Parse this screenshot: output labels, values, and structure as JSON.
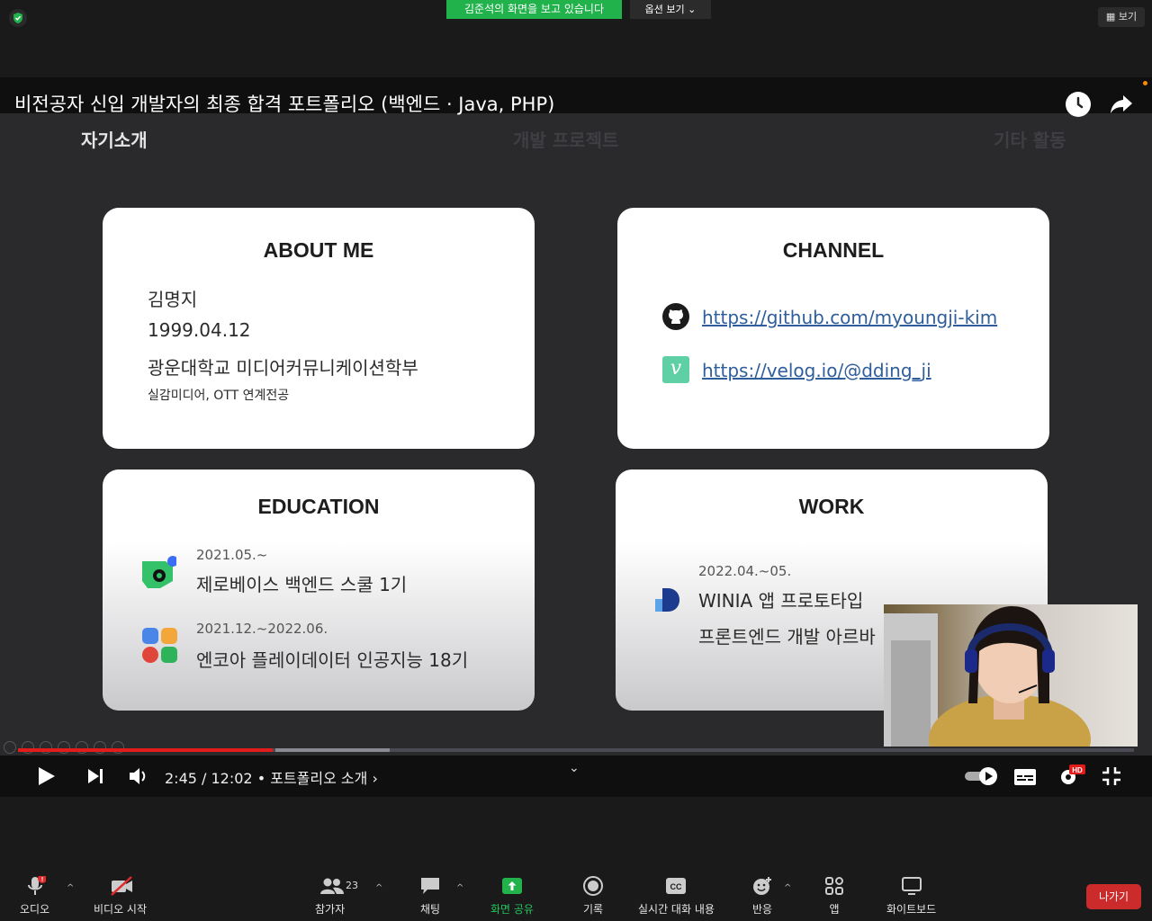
{
  "zoom": {
    "sharing_banner": "김준석의 화면을 보고 있습니다",
    "view_options": "옵션 보기",
    "view_button": "보기",
    "toolbar": [
      {
        "label": "오디오",
        "icon": "mic-icon"
      },
      {
        "label": "비디오 시작",
        "icon": "video-off-icon"
      },
      {
        "label": "참가자",
        "icon": "participants-icon"
      },
      {
        "label": "채팅",
        "icon": "chat-icon"
      },
      {
        "label": "화면 공유",
        "icon": "share-screen-icon"
      },
      {
        "label": "기록",
        "icon": "record-icon"
      },
      {
        "label": "실시간 대화 내용",
        "icon": "cc-icon"
      },
      {
        "label": "반응",
        "icon": "reaction-icon"
      },
      {
        "label": "앱",
        "icon": "apps-icon"
      },
      {
        "label": "화이트보드",
        "icon": "whiteboard-icon"
      }
    ],
    "participants_count": "23",
    "leave_button": "나가기",
    "share_accent": "#22b24c",
    "leave_color": "#cc2b2b"
  },
  "video": {
    "title": "비전공자 신입 개발자의 최종 합격 포트폴리오 (백엔드 · Java, PHP)",
    "slide_tabs": [
      "자기소개",
      "개발 프로젝트",
      "기타 활동"
    ],
    "about": {
      "title": "ABOUT ME",
      "name": "김명지",
      "birth": "1999.04.12",
      "school": "광운대학교 미디어커뮤니케이션학부",
      "major": "실감미디어, OTT 연계전공"
    },
    "channel": {
      "title": "CHANNEL",
      "github": "https://github.com/myoungji-kim",
      "velog": "https://velog.io/@dding_ji"
    },
    "education": {
      "title": "EDUCATION",
      "items": [
        {
          "date": "2021.05.~",
          "name": "제로베이스 백엔드 스쿨 1기"
        },
        {
          "date": "2021.12.~2022.06.",
          "name": "엔코아 플레이데이터 인공지능 18기"
        }
      ]
    },
    "work": {
      "title": "WORK",
      "date": "2022.04.~05.",
      "line1": "WINIA 앱 프로토타입",
      "line2": "프론트엔드 개발 아르바"
    },
    "player": {
      "time": "2:45 / 12:02",
      "chapter": "• 포트폴리오 소개 ›",
      "progress": 0.228
    }
  }
}
